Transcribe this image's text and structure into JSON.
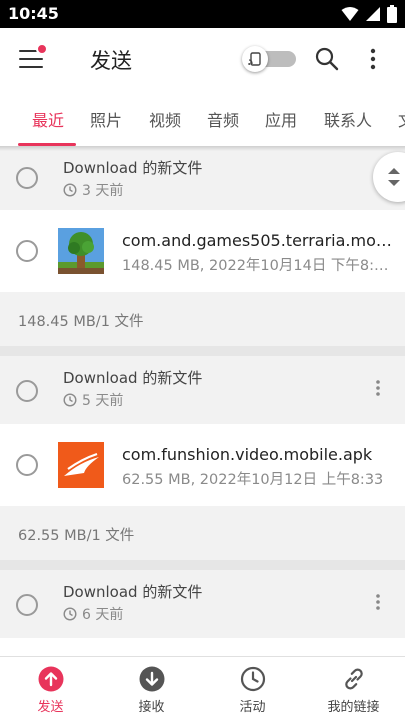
{
  "status_bar": {
    "time": "10:45"
  },
  "app_bar": {
    "title": "发送",
    "menu_icon": "hamburger-menu-icon",
    "search_icon": "search-icon",
    "more_icon": "more-vert-icon"
  },
  "tabs": [
    {
      "label": "最近",
      "active": true
    },
    {
      "label": "照片"
    },
    {
      "label": "视频"
    },
    {
      "label": "音频"
    },
    {
      "label": "应用"
    },
    {
      "label": "联系人"
    },
    {
      "label": "文"
    }
  ],
  "groups": [
    {
      "title": "Download 的新文件",
      "time": "3 天前",
      "file": {
        "name": "com.and.games505.terraria.mod_…",
        "meta": "148.45 MB, 2022年10月14日 下午8:…",
        "thumb": "terraria-tree-icon"
      },
      "summary": "148.45 MB/1 文件"
    },
    {
      "title": "Download 的新文件",
      "time": "5 天前",
      "file": {
        "name": "com.funshion.video.mobile.apk",
        "meta": "62.55 MB, 2022年10月12日 上午8:33",
        "thumb": "funshion-app-icon"
      },
      "summary": "62.55 MB/1 文件"
    },
    {
      "title": "Download 的新文件",
      "time": "6 天前"
    }
  ],
  "bottom_nav": [
    {
      "label": "发送",
      "icon": "upload-arrow-icon",
      "active": true
    },
    {
      "label": "接收",
      "icon": "download-arrow-icon"
    },
    {
      "label": "活动",
      "icon": "clock-icon"
    },
    {
      "label": "我的链接",
      "icon": "link-icon"
    }
  ],
  "colors": {
    "accent": "#e8345b",
    "background": "#f2f2f2",
    "text_secondary": "#8a8a8a"
  }
}
